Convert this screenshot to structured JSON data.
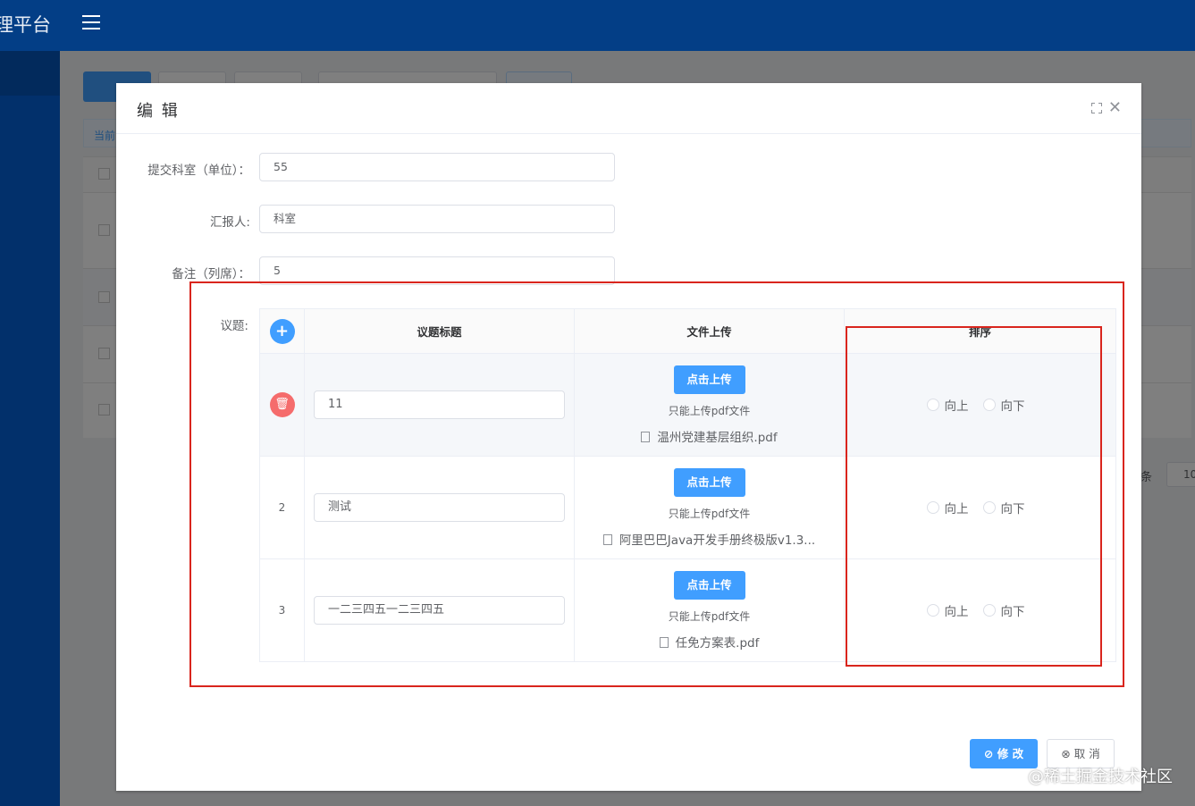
{
  "app": {
    "title": "理平台"
  },
  "dialog": {
    "title": "编 辑",
    "fields": [
      {
        "label": "提交科室（单位）：",
        "value": "55"
      },
      {
        "label": "汇报人:",
        "value": "科室"
      },
      {
        "label": "备注（列席）：",
        "value": "5"
      }
    ],
    "topics_label": "议题:",
    "table": {
      "headers": [
        "议题标题",
        "文件上传",
        "排序"
      ],
      "rows": [
        {
          "index": "",
          "title": "11",
          "upload_label": "点击上传",
          "hint": "只能上传pdf文件",
          "file": "温州党建基层组织.pdf",
          "up": "向上",
          "down": "向下"
        },
        {
          "index": "2",
          "title": "测试",
          "upload_label": "点击上传",
          "hint": "只能上传pdf文件",
          "file": "阿里巴巴Java开发手册终极版v1.3...",
          "up": "向上",
          "down": "向下"
        },
        {
          "index": "3",
          "title": "一二三四五一二三四五",
          "upload_label": "点击上传",
          "hint": "只能上传pdf文件",
          "file": "任免方案表.pdf",
          "up": "向上",
          "down": "向下"
        }
      ]
    },
    "buttons": {
      "submit": "修 改",
      "cancel": "取 消"
    }
  },
  "background": {
    "current_label": "当前",
    "page_unit": "条",
    "page_size": "10"
  },
  "watermark": "@稀土掘金技术社区",
  "colors": {
    "primary": "#409eff",
    "danger": "#f56c6c",
    "header": "#033e86",
    "annotation": "#d9251d"
  }
}
